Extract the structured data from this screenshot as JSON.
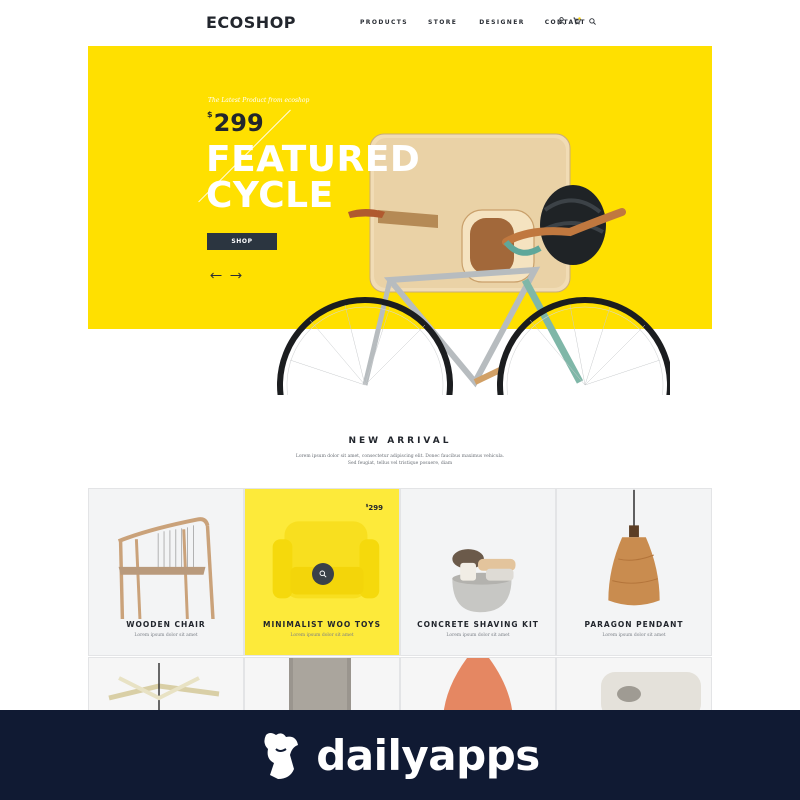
{
  "header": {
    "logo": "ECOSHOP",
    "nav": [
      "PRODUCTS",
      "STORE",
      "DESIGNER",
      "CONTACT"
    ],
    "icons": [
      "user-icon",
      "cart-icon",
      "search-icon"
    ]
  },
  "hero": {
    "label": "The Latest Product from ecoshop",
    "price_currency": "$",
    "price": "299",
    "title_line1": "FEATURED",
    "title_line2": "CYCLE",
    "button": "SHOP",
    "background": "#ffe000",
    "arrows": [
      "arrow-left-icon",
      "arrow-right-icon"
    ]
  },
  "new_arrival": {
    "title": "NEW ARRIVAL",
    "desc_line1": "Lorem ipsum dolor sit amet, consectetur adipiscing elit. Donec faucibus maximus vehicula.",
    "desc_line2": "Sed feugiat, tellus vel tristique posuere, diam"
  },
  "products": [
    {
      "name": "WOODEN CHAIR",
      "sub": "Lorem ipsum dolor sit amet"
    },
    {
      "name": "MINIMALIST WOO TOYS",
      "sub": "Lorem ipsum dolor sit amet",
      "price_currency": "$",
      "price": "299"
    },
    {
      "name": "CONCRETE SHAVING KIT",
      "sub": "Lorem ipsum dolor sit amet"
    },
    {
      "name": "PARAGON PENDANT",
      "sub": "Lorem ipsum dolor sit amet"
    }
  ],
  "brand": {
    "name": "dailyapps",
    "background": "#101a33"
  }
}
